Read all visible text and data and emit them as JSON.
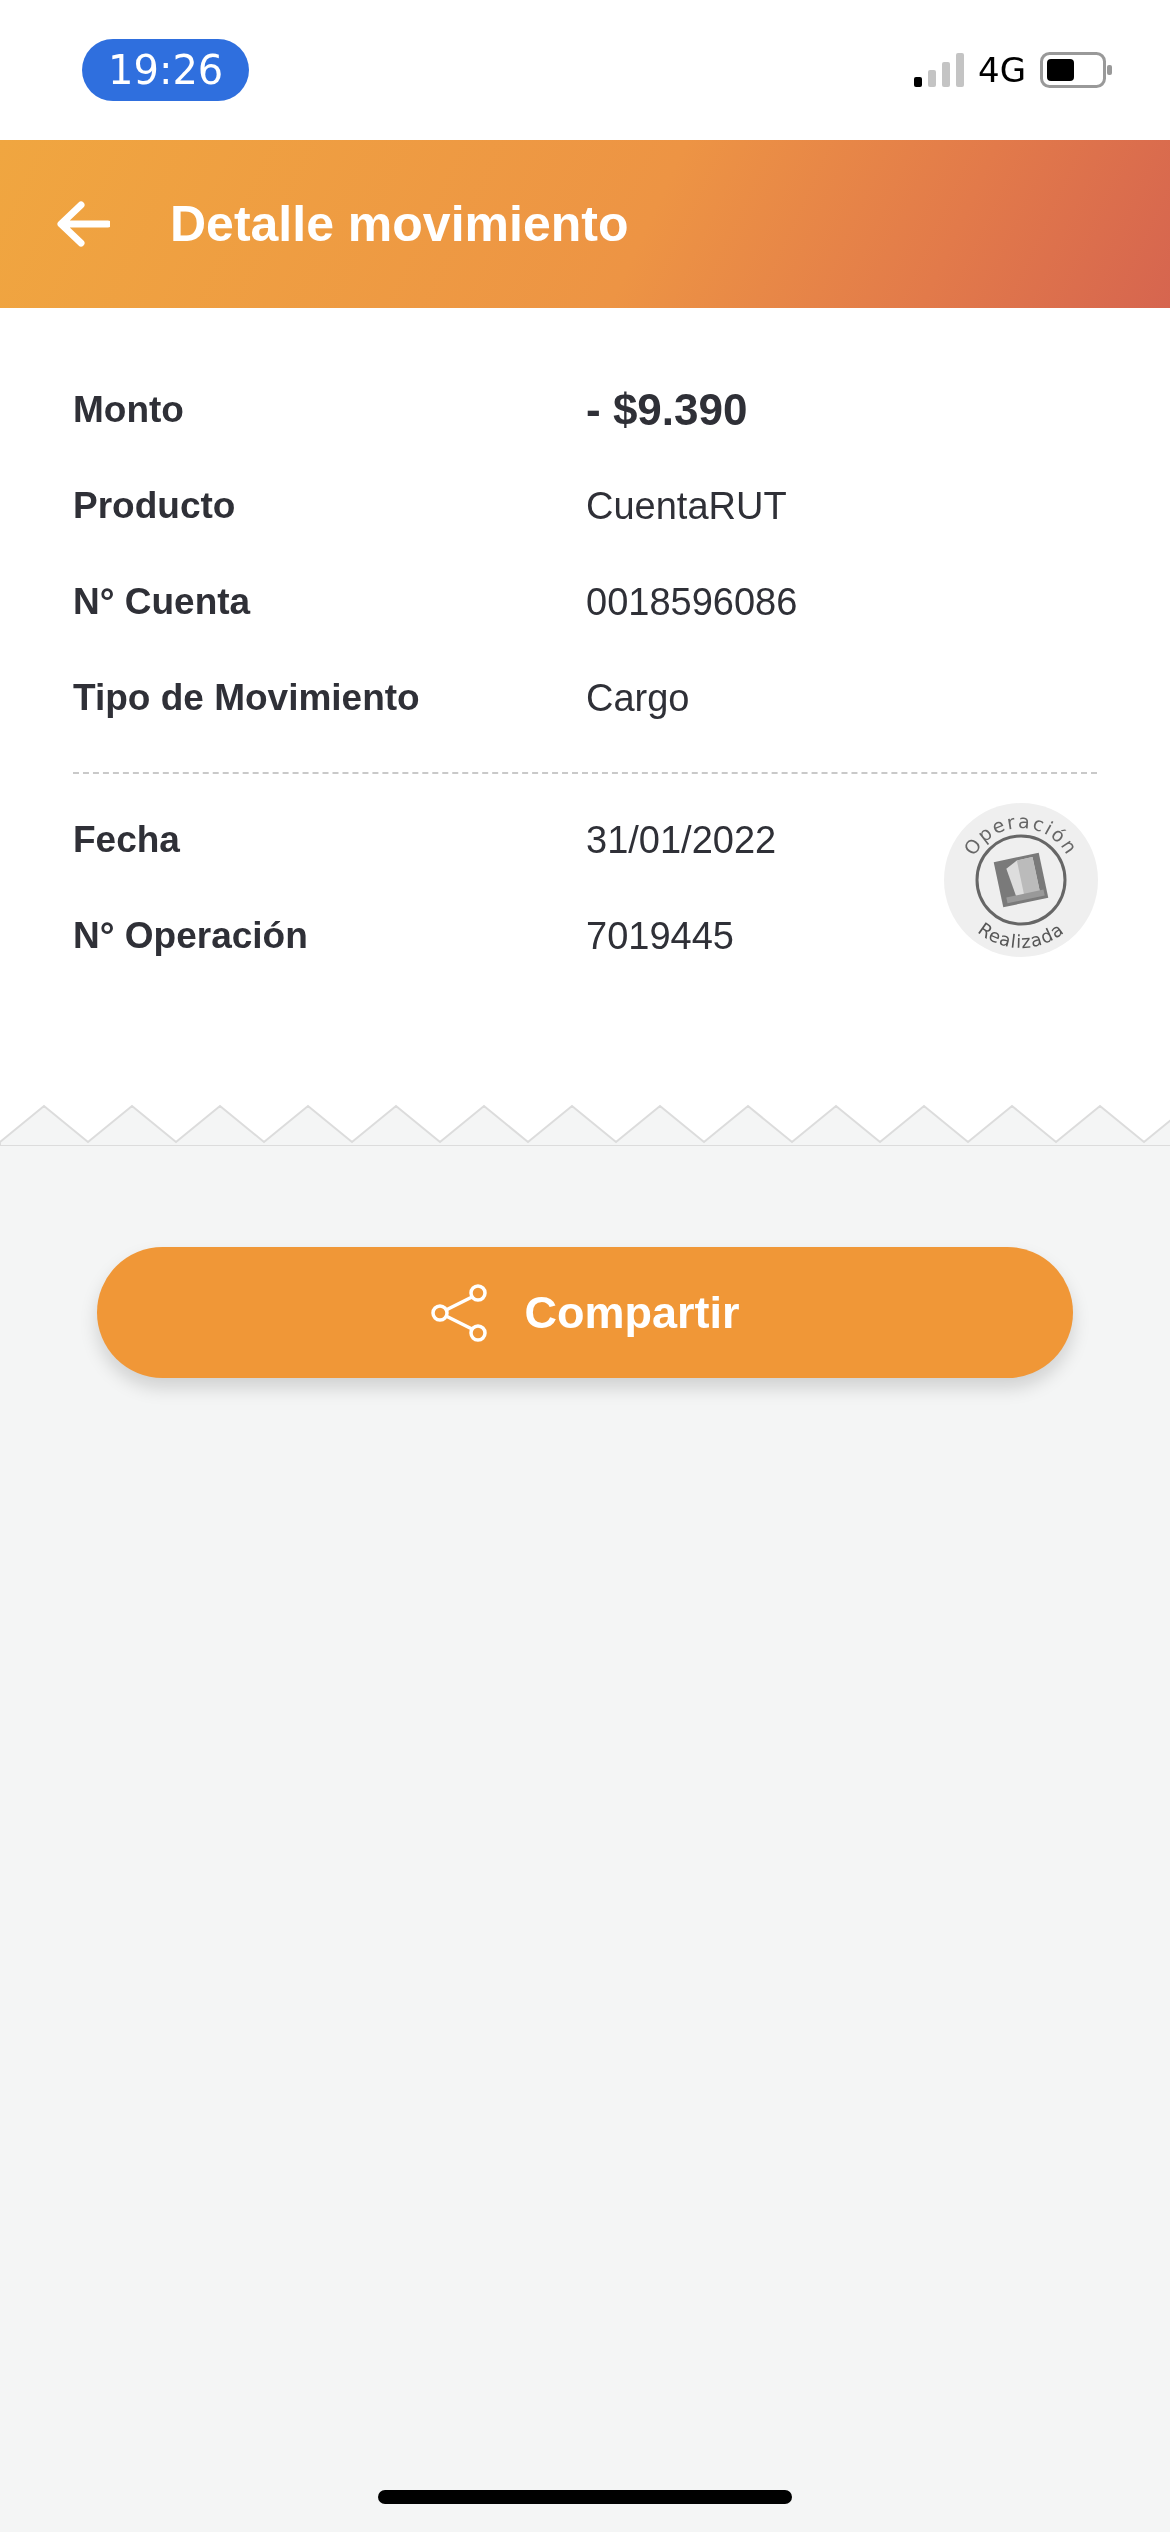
{
  "status_bar": {
    "time": "19:26",
    "network": "4G"
  },
  "header": {
    "title": "Detalle movimiento"
  },
  "sections": [
    {
      "rows": [
        {
          "label": "Monto",
          "value": "- $9.390",
          "kind": "amount"
        },
        {
          "label": "Producto",
          "value": "CuentaRUT",
          "kind": "plain"
        },
        {
          "label": "N° Cuenta",
          "value": "0018596086",
          "kind": "plain"
        },
        {
          "label": "Tipo de Movimiento",
          "value": "Cargo",
          "kind": "plain"
        }
      ]
    },
    {
      "rows": [
        {
          "label": "Fecha",
          "value": "31/01/2022",
          "kind": "plain"
        },
        {
          "label": "N° Operación",
          "value": "7019445",
          "kind": "plain"
        }
      ]
    }
  ],
  "stamp": {
    "top_text": "Operación",
    "bottom_text": "Realizada"
  },
  "share_button": {
    "label": "Compartir"
  }
}
